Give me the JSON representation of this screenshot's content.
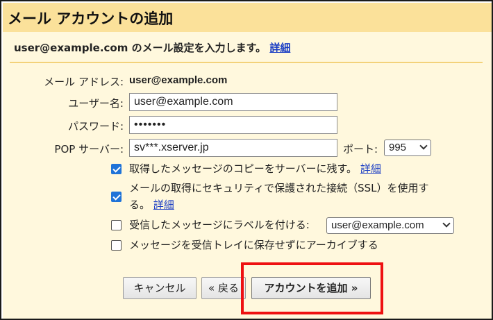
{
  "dialog": {
    "title": "メール アカウントの追加",
    "subhead_text": "user@example.com のメール設定を入力します。",
    "subhead_link": "詳細"
  },
  "form": {
    "email_label": "メール アドレス:",
    "email_value": "user@example.com",
    "username_label": "ユーザー名:",
    "username_value": "user@example.com",
    "password_label": "パスワード:",
    "password_value": "•••••••",
    "pop_label": "POP サーバー:",
    "pop_value": "sv***.xserver.jp",
    "port_label": "ポート:",
    "port_value": "995"
  },
  "options": [
    {
      "text": "取得したメッセージのコピーをサーバーに残す。",
      "link": "詳細",
      "checked": true
    },
    {
      "text_line1": "メールの取得にセキュリティで保護された接続（SSL）を使用す",
      "text_line2": "る。",
      "link": "詳細",
      "checked": true
    },
    {
      "text": "受信したメッセージにラベルを付ける:",
      "select_value": "user@example.com",
      "checked": false
    },
    {
      "text": "メッセージを受信トレイに保存せずにアーカイブする",
      "checked": false
    }
  ],
  "buttons": {
    "cancel": "キャンセル",
    "back": "« 戻る",
    "add": "アカウントを追加 »"
  },
  "colors": {
    "title_bg": "#fbe19a",
    "panel_bg": "#fff8dd",
    "link": "#1a3dc4",
    "checkbox_accent": "#1f73d8",
    "highlight": "#ee1111"
  }
}
